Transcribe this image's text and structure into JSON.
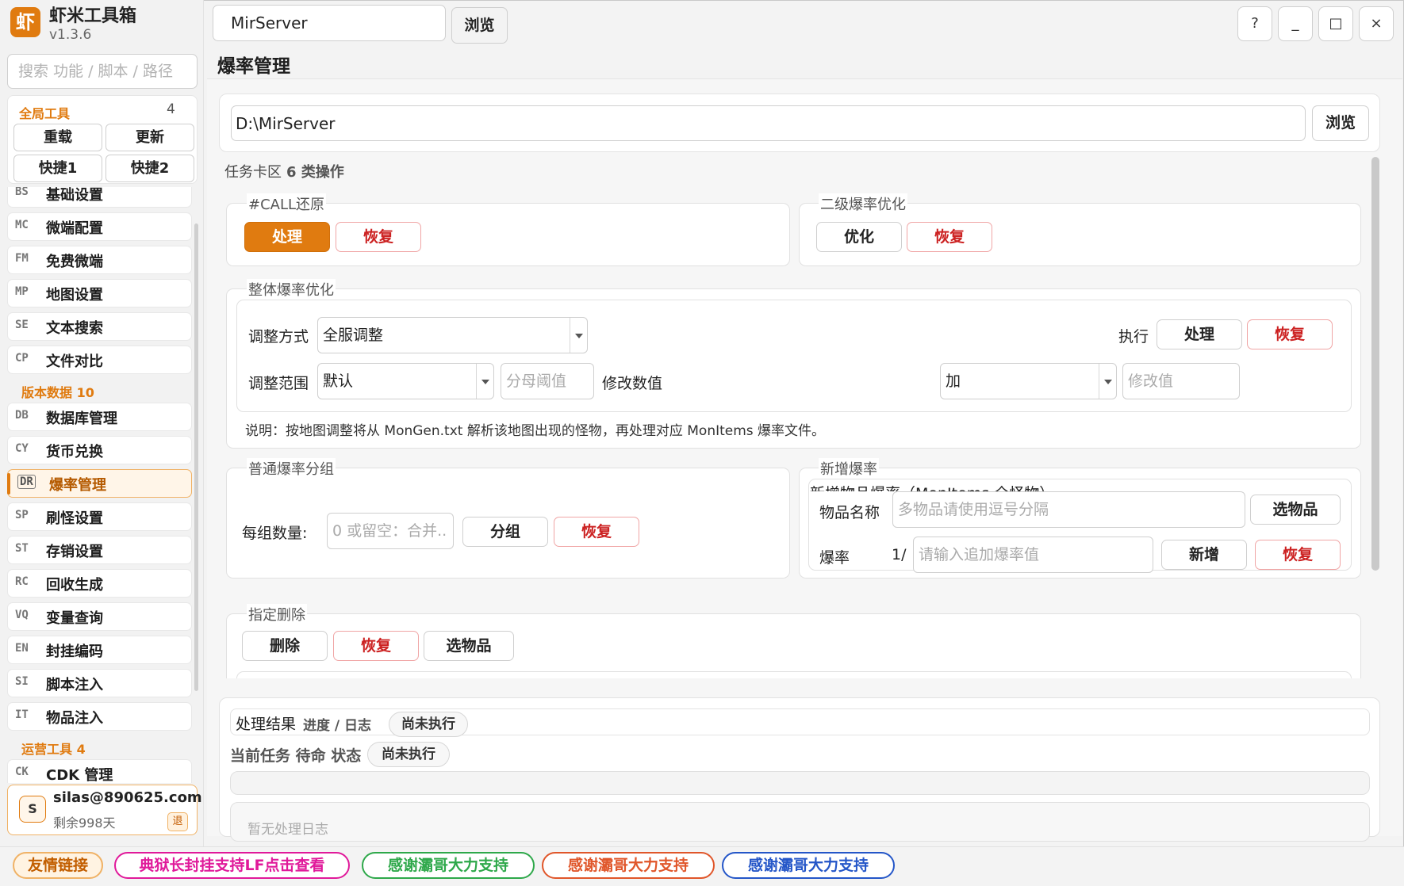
{
  "app": {
    "logo_char": "虾",
    "name": "虾米工具箱",
    "version": "v1.3.6"
  },
  "sidebar": {
    "search_placeholder": "搜索 功能 / 脚本 / 路径",
    "global": {
      "title": "全局工具",
      "count": "4",
      "buttons": [
        "重载",
        "更新",
        "快捷1",
        "快捷2"
      ]
    },
    "items": [
      {
        "code": "BS",
        "label": "基础设置"
      },
      {
        "code": "MC",
        "label": "微端配置"
      },
      {
        "code": "FM",
        "label": "免费微端"
      },
      {
        "code": "MP",
        "label": "地图设置"
      },
      {
        "code": "SE",
        "label": "文本搜索"
      },
      {
        "code": "CP",
        "label": "文件对比"
      },
      {
        "code": "DB",
        "label": "数据库管理"
      },
      {
        "code": "CY",
        "label": "货币兑换"
      },
      {
        "code": "DR",
        "label": "爆率管理"
      },
      {
        "code": "SP",
        "label": "刷怪设置"
      },
      {
        "code": "ST",
        "label": "存销设置"
      },
      {
        "code": "RC",
        "label": "回收生成"
      },
      {
        "code": "VQ",
        "label": "变量查询"
      },
      {
        "code": "EN",
        "label": "封挂编码"
      },
      {
        "code": "SI",
        "label": "脚本注入"
      },
      {
        "code": "IT",
        "label": "物品注入"
      },
      {
        "code": "CK",
        "label": "CDK 管理"
      }
    ],
    "groups": {
      "version_data": "版本数据  10",
      "ops_tools": "运营工具  4"
    },
    "user": {
      "avatar": "S",
      "email": "silas@890625.com",
      "days": "剩余998天",
      "logout": "退"
    }
  },
  "topbar": {
    "path_value": "MirServer",
    "browse": "浏览",
    "window_buttons": [
      "?",
      "_",
      "□",
      "×"
    ]
  },
  "page": {
    "title": "爆率管理"
  },
  "main": {
    "path_value": "D:\\MirServer",
    "browse": "浏览",
    "task_zone_label": "任务卡区",
    "task_zone_count": "6 类操作",
    "call_restore": {
      "title": "#CALL还原",
      "process": "处理",
      "restore": "恢复"
    },
    "second_level": {
      "title": "二级爆率优化",
      "optimize": "优化",
      "restore": "恢复"
    },
    "overall": {
      "title": "整体爆率优化",
      "mode_label": "调整方式",
      "mode_value": "全服调整",
      "execute_label": "执行",
      "process": "处理",
      "restore": "恢复",
      "range_label": "调整范围",
      "range_value": "默认",
      "denominator_placeholder": "分母阈值",
      "modify_label": "修改数值",
      "op_value": "加",
      "modify_placeholder": "修改值",
      "note": "说明：按地图调整将从 MonGen.txt 解析该地图出现的怪物，再处理对应 MonItems 爆率文件。"
    },
    "group_rate": {
      "title": "普通爆率分组",
      "count_label": "每组数量:",
      "count_placeholder": "0 或留空：合并...",
      "group": "分组",
      "restore": "恢复"
    },
    "add_rate": {
      "title": "新增爆率",
      "subtitle": "新增物品爆率（MonItems 全怪物）",
      "item_label": "物品名称",
      "item_placeholder": "多物品请使用逗号分隔",
      "select_item": "选物品",
      "rate_label": "爆率",
      "rate_prefix": "1/",
      "rate_placeholder": "请输入追加爆率值",
      "add": "新增",
      "restore": "恢复"
    },
    "delete": {
      "title": "指定删除",
      "delete": "删除",
      "restore": "恢复",
      "select_item": "选物品"
    }
  },
  "result": {
    "title": "处理结果",
    "subtitle": "进度 / 日志",
    "status_chip": "尚未执行",
    "current_task": "当前任务 待命 状态",
    "current_chip": "尚未执行",
    "log_empty": "暂无处理日志"
  },
  "footer_links": [
    {
      "label": "友情链接",
      "color": "#e07b10"
    },
    {
      "label": "典狱长封挂支持LF点击查看",
      "color": "#e0199a"
    },
    {
      "label": "感谢灞哥大力支持",
      "color": "#2ea84a"
    },
    {
      "label": "感谢灞哥大力支持",
      "color": "#e0562a"
    },
    {
      "label": "感谢灞哥大力支持",
      "color": "#2456c8"
    }
  ]
}
